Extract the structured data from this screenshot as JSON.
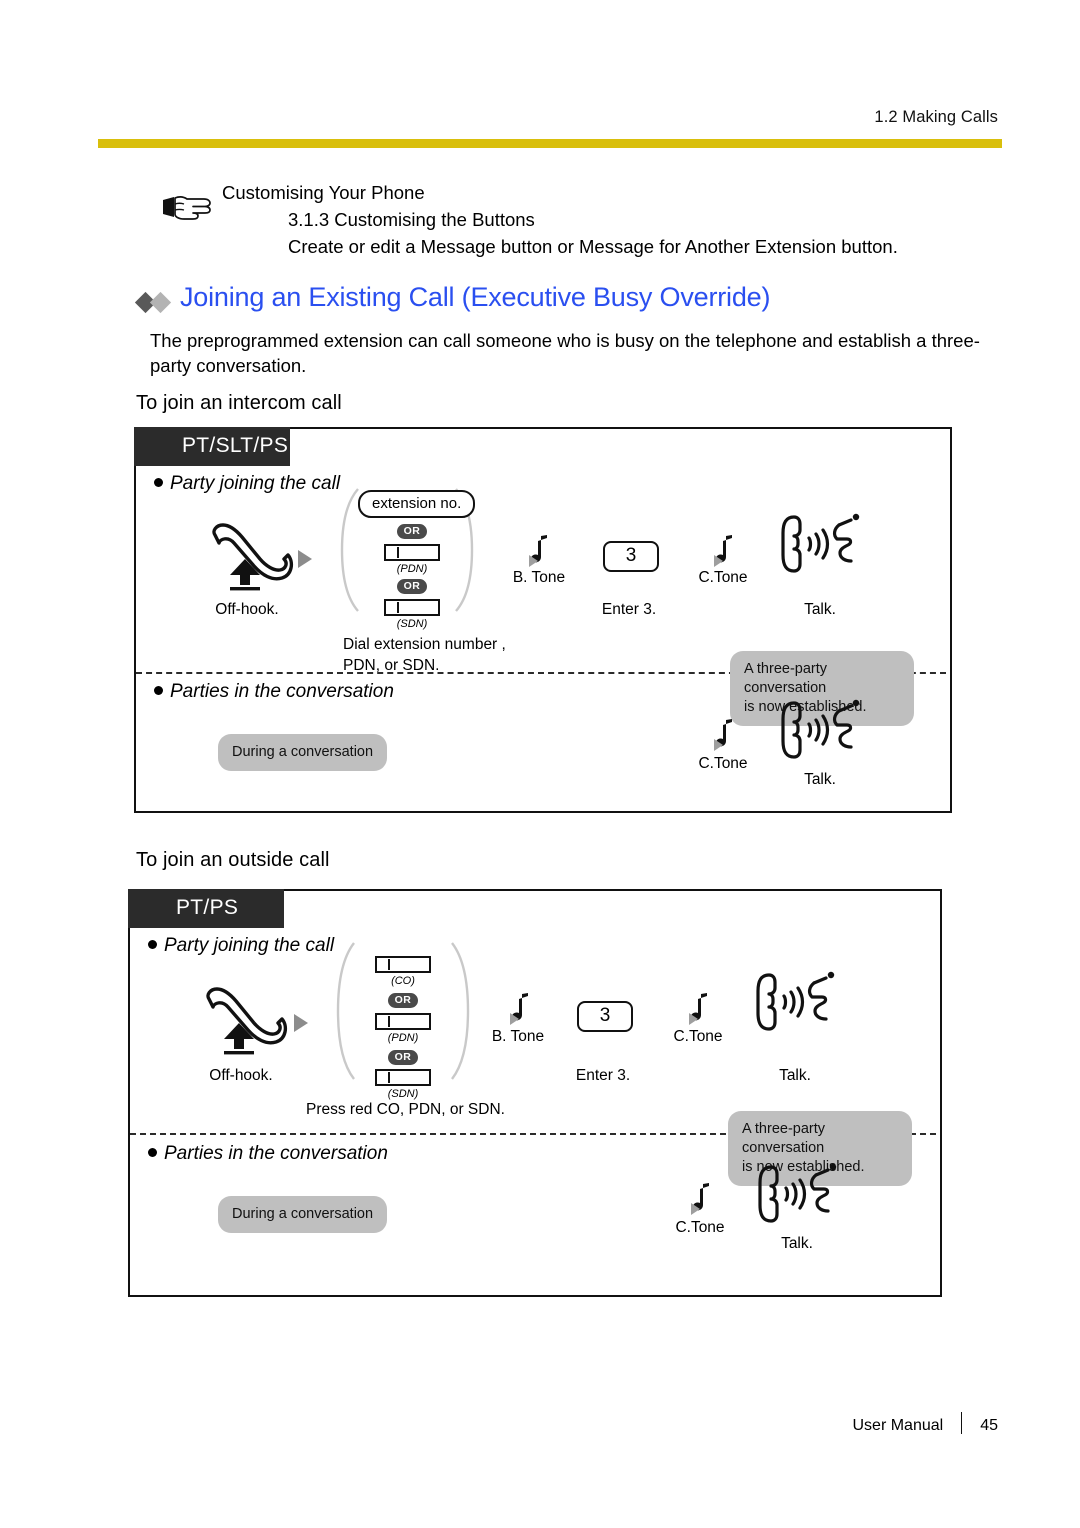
{
  "header": {
    "running_head": "1.2 Making Calls",
    "rule_color": "#d9bf0c"
  },
  "note": {
    "icon": "pointing-hand-icon",
    "line1": "Customising Your Phone",
    "line2": "3.1.3 Customising the Buttons",
    "line3": "Create or edit a Message button or Message for Another Extension button."
  },
  "section": {
    "title": "Joining an Existing Call (Executive Busy Override)",
    "title_color": "#2a4ff0",
    "body": "The preprogrammed extension can call someone who is busy on the telephone and establish a three-party conversation."
  },
  "subheads": {
    "intercom": "To join an intercom call",
    "outside": "To join an outside call"
  },
  "diagram_intercom": {
    "tag": "PT/SLT/PS",
    "row1_title": "Party joining the call",
    "row2_title": "Parties in the conversation",
    "offhook_caption": "Off-hook.",
    "extension_box": "extension no.",
    "or_label": "OR",
    "pdn_label": "(PDN)",
    "sdn_label": "(SDN)",
    "dial_caption_line1": "Dial extension number  ,",
    "dial_caption_line2": "PDN, or SDN.",
    "btone_caption": "B. Tone",
    "keycap": "3",
    "enter_caption": "Enter 3.",
    "ctone_caption": "C.Tone",
    "talk_caption": "Talk.",
    "established_line1": "A three-party conversation",
    "established_line2": "is now established.",
    "during_caption": "During a conversation",
    "ctone_caption2": "C.Tone",
    "talk_caption2": "Talk."
  },
  "diagram_outside": {
    "tag": "PT/PS",
    "row1_title": "Party joining the call",
    "row2_title": "Parties in the conversation",
    "offhook_caption": "Off-hook.",
    "co_label": "(CO)",
    "or_label": "OR",
    "pdn_label": "(PDN)",
    "sdn_label": "(SDN)",
    "press_caption": "Press red CO, PDN, or SDN.",
    "btone_caption": "B. Tone",
    "keycap": "3",
    "enter_caption": "Enter 3.",
    "ctone_caption": "C.Tone",
    "talk_caption": "Talk.",
    "established_line1": "A three-party conversation",
    "established_line2": "is now established.",
    "during_caption": "During a conversation",
    "ctone_caption2": "C.Tone",
    "talk_caption2": "Talk."
  },
  "footer": {
    "label": "User Manual",
    "page": "45"
  }
}
